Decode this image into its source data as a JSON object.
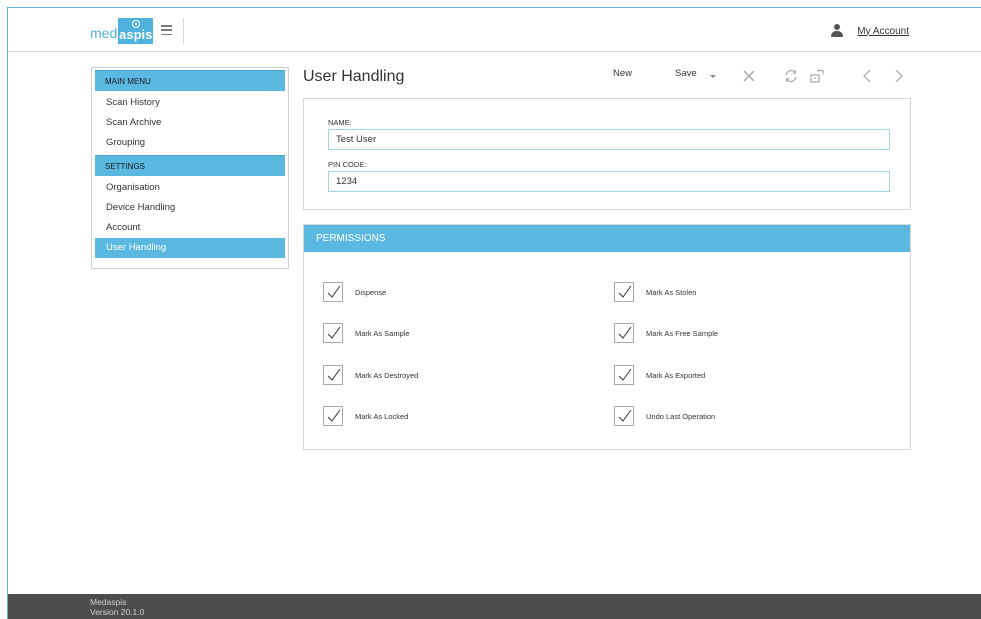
{
  "header": {
    "logo_med": "med",
    "logo_aspis": "aspis",
    "account_label": "My Account"
  },
  "sidebar": {
    "main_menu_title": "MAIN MENU",
    "main_items": [
      {
        "label": "Scan History"
      },
      {
        "label": "Scan Archive"
      },
      {
        "label": "Grouping"
      }
    ],
    "settings_title": "SETTINGS",
    "settings_items": [
      {
        "label": "Organisation"
      },
      {
        "label": "Device Handling"
      },
      {
        "label": "Account"
      },
      {
        "label": "User Handling",
        "active": true
      }
    ]
  },
  "page": {
    "title": "User Handling"
  },
  "toolbar": {
    "new_label": "New",
    "save_label": "Save",
    "icons": [
      "close-icon",
      "refresh-icon",
      "unlock-icon",
      "chevron-left-icon",
      "chevron-right-icon"
    ]
  },
  "form": {
    "name_label": "NAME:",
    "name_value": "Test User",
    "pin_label": "PIN CODE:",
    "pin_value": "1234"
  },
  "permissions": {
    "title": "PERMISSIONS",
    "items": [
      {
        "label": "Dispense",
        "checked": true
      },
      {
        "label": "Mark As Stolen",
        "checked": true
      },
      {
        "label": "Mark As Sample",
        "checked": true
      },
      {
        "label": "Mark As Free Sample",
        "checked": true
      },
      {
        "label": "Mark As Destroyed",
        "checked": true
      },
      {
        "label": "Mark As Exported",
        "checked": true
      },
      {
        "label": "Mark As Locked",
        "checked": true
      },
      {
        "label": "Undo Last Operation",
        "checked": true
      }
    ]
  },
  "footer": {
    "app_name": "Medaspis",
    "version": "Version 20.1.0"
  },
  "colors": {
    "accent": "#5bb8e0",
    "footer_bg": "#4d4d4d"
  }
}
